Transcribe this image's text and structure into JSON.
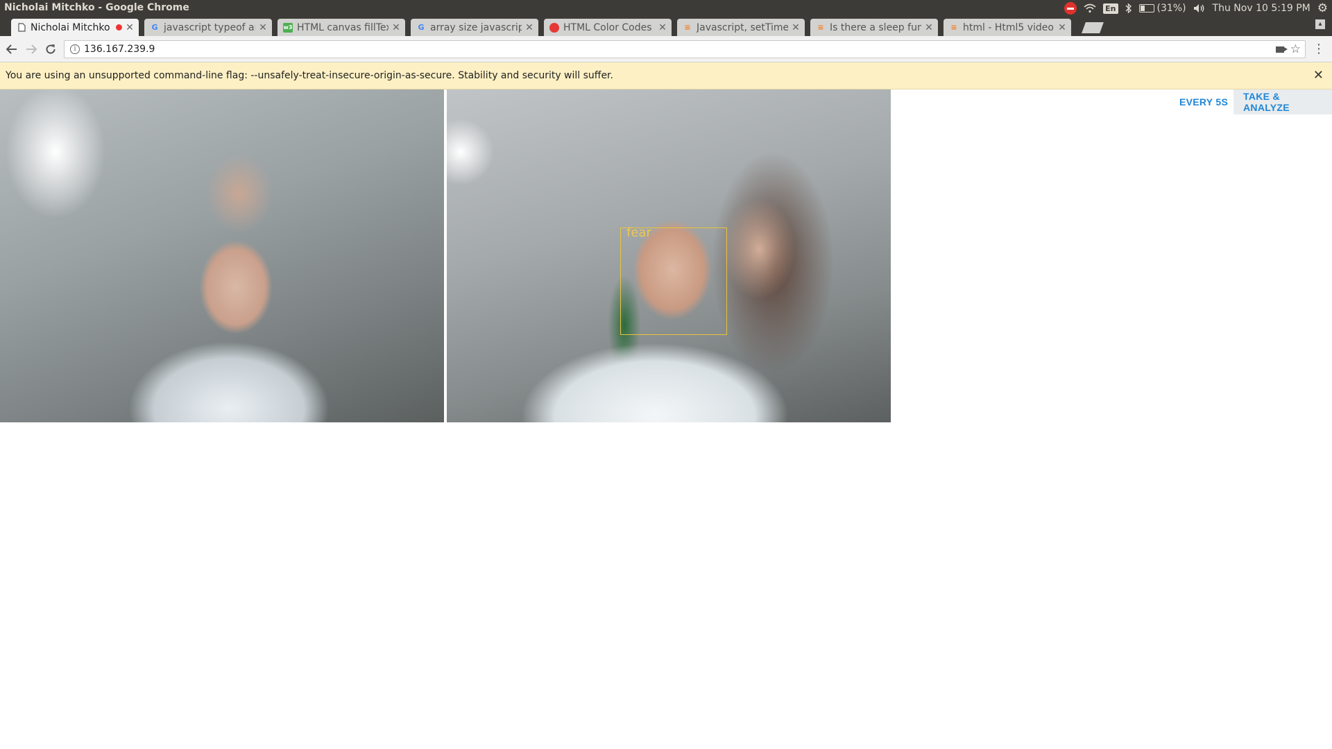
{
  "os_panel": {
    "window_title": "Nicholai Mitchko - Google Chrome",
    "battery": "(31%)",
    "lang": "En",
    "clock": "Thu Nov 10  5:19 PM"
  },
  "tabs": [
    {
      "title": "Nicholai Mitchko",
      "favicon": "page-icon",
      "active": true,
      "recording": true
    },
    {
      "title": "javascript typeof ar",
      "favicon": "google-icon",
      "active": false
    },
    {
      "title": "HTML canvas fillTex",
      "favicon": "w3schools-icon",
      "active": false
    },
    {
      "title": "array size javascrip",
      "favicon": "google-icon",
      "active": false
    },
    {
      "title": "HTML Color Codes",
      "favicon": "colorwheel-icon",
      "active": false
    },
    {
      "title": "Javascript, setTime",
      "favicon": "stackoverflow-icon",
      "active": false
    },
    {
      "title": "Is there a sleep fun",
      "favicon": "stackoverflow-icon",
      "active": false
    },
    {
      "title": "html - Html5 video",
      "favicon": "stackoverflow-icon",
      "active": false
    }
  ],
  "toolbar": {
    "url": "136.167.239.9"
  },
  "infobar": {
    "message": "You are using an unsupported command-line flag: --unsafely-treat-insecure-origin-as-secure. Stability and security will suffer."
  },
  "page": {
    "emotion_label": "fear",
    "every_button": "EVERY 5S",
    "take_button": "TAKE & ANALYZE"
  },
  "colors": {
    "link_blue": "#1f86d7",
    "face_box": "#e8c33b",
    "infobar_bg": "#fdf0c4"
  }
}
